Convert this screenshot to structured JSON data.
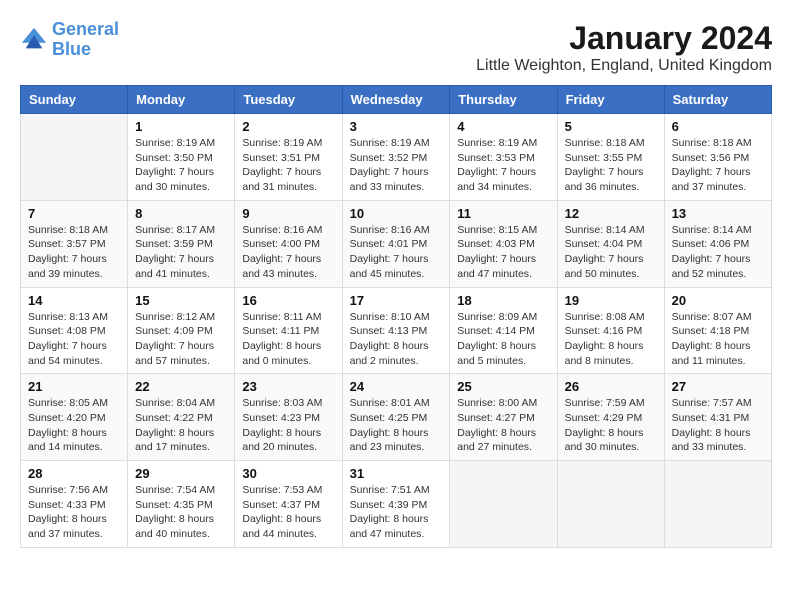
{
  "logo": {
    "line1": "General",
    "line2": "Blue"
  },
  "title": "January 2024",
  "location": "Little Weighton, England, United Kingdom",
  "days_header": [
    "Sunday",
    "Monday",
    "Tuesday",
    "Wednesday",
    "Thursday",
    "Friday",
    "Saturday"
  ],
  "weeks": [
    [
      {
        "day": "",
        "info": ""
      },
      {
        "day": "1",
        "info": "Sunrise: 8:19 AM\nSunset: 3:50 PM\nDaylight: 7 hours\nand 30 minutes."
      },
      {
        "day": "2",
        "info": "Sunrise: 8:19 AM\nSunset: 3:51 PM\nDaylight: 7 hours\nand 31 minutes."
      },
      {
        "day": "3",
        "info": "Sunrise: 8:19 AM\nSunset: 3:52 PM\nDaylight: 7 hours\nand 33 minutes."
      },
      {
        "day": "4",
        "info": "Sunrise: 8:19 AM\nSunset: 3:53 PM\nDaylight: 7 hours\nand 34 minutes."
      },
      {
        "day": "5",
        "info": "Sunrise: 8:18 AM\nSunset: 3:55 PM\nDaylight: 7 hours\nand 36 minutes."
      },
      {
        "day": "6",
        "info": "Sunrise: 8:18 AM\nSunset: 3:56 PM\nDaylight: 7 hours\nand 37 minutes."
      }
    ],
    [
      {
        "day": "7",
        "info": "Sunrise: 8:18 AM\nSunset: 3:57 PM\nDaylight: 7 hours\nand 39 minutes."
      },
      {
        "day": "8",
        "info": "Sunrise: 8:17 AM\nSunset: 3:59 PM\nDaylight: 7 hours\nand 41 minutes."
      },
      {
        "day": "9",
        "info": "Sunrise: 8:16 AM\nSunset: 4:00 PM\nDaylight: 7 hours\nand 43 minutes."
      },
      {
        "day": "10",
        "info": "Sunrise: 8:16 AM\nSunset: 4:01 PM\nDaylight: 7 hours\nand 45 minutes."
      },
      {
        "day": "11",
        "info": "Sunrise: 8:15 AM\nSunset: 4:03 PM\nDaylight: 7 hours\nand 47 minutes."
      },
      {
        "day": "12",
        "info": "Sunrise: 8:14 AM\nSunset: 4:04 PM\nDaylight: 7 hours\nand 50 minutes."
      },
      {
        "day": "13",
        "info": "Sunrise: 8:14 AM\nSunset: 4:06 PM\nDaylight: 7 hours\nand 52 minutes."
      }
    ],
    [
      {
        "day": "14",
        "info": "Sunrise: 8:13 AM\nSunset: 4:08 PM\nDaylight: 7 hours\nand 54 minutes."
      },
      {
        "day": "15",
        "info": "Sunrise: 8:12 AM\nSunset: 4:09 PM\nDaylight: 7 hours\nand 57 minutes."
      },
      {
        "day": "16",
        "info": "Sunrise: 8:11 AM\nSunset: 4:11 PM\nDaylight: 8 hours\nand 0 minutes."
      },
      {
        "day": "17",
        "info": "Sunrise: 8:10 AM\nSunset: 4:13 PM\nDaylight: 8 hours\nand 2 minutes."
      },
      {
        "day": "18",
        "info": "Sunrise: 8:09 AM\nSunset: 4:14 PM\nDaylight: 8 hours\nand 5 minutes."
      },
      {
        "day": "19",
        "info": "Sunrise: 8:08 AM\nSunset: 4:16 PM\nDaylight: 8 hours\nand 8 minutes."
      },
      {
        "day": "20",
        "info": "Sunrise: 8:07 AM\nSunset: 4:18 PM\nDaylight: 8 hours\nand 11 minutes."
      }
    ],
    [
      {
        "day": "21",
        "info": "Sunrise: 8:05 AM\nSunset: 4:20 PM\nDaylight: 8 hours\nand 14 minutes."
      },
      {
        "day": "22",
        "info": "Sunrise: 8:04 AM\nSunset: 4:22 PM\nDaylight: 8 hours\nand 17 minutes."
      },
      {
        "day": "23",
        "info": "Sunrise: 8:03 AM\nSunset: 4:23 PM\nDaylight: 8 hours\nand 20 minutes."
      },
      {
        "day": "24",
        "info": "Sunrise: 8:01 AM\nSunset: 4:25 PM\nDaylight: 8 hours\nand 23 minutes."
      },
      {
        "day": "25",
        "info": "Sunrise: 8:00 AM\nSunset: 4:27 PM\nDaylight: 8 hours\nand 27 minutes."
      },
      {
        "day": "26",
        "info": "Sunrise: 7:59 AM\nSunset: 4:29 PM\nDaylight: 8 hours\nand 30 minutes."
      },
      {
        "day": "27",
        "info": "Sunrise: 7:57 AM\nSunset: 4:31 PM\nDaylight: 8 hours\nand 33 minutes."
      }
    ],
    [
      {
        "day": "28",
        "info": "Sunrise: 7:56 AM\nSunset: 4:33 PM\nDaylight: 8 hours\nand 37 minutes."
      },
      {
        "day": "29",
        "info": "Sunrise: 7:54 AM\nSunset: 4:35 PM\nDaylight: 8 hours\nand 40 minutes."
      },
      {
        "day": "30",
        "info": "Sunrise: 7:53 AM\nSunset: 4:37 PM\nDaylight: 8 hours\nand 44 minutes."
      },
      {
        "day": "31",
        "info": "Sunrise: 7:51 AM\nSunset: 4:39 PM\nDaylight: 8 hours\nand 47 minutes."
      },
      {
        "day": "",
        "info": ""
      },
      {
        "day": "",
        "info": ""
      },
      {
        "day": "",
        "info": ""
      }
    ]
  ]
}
